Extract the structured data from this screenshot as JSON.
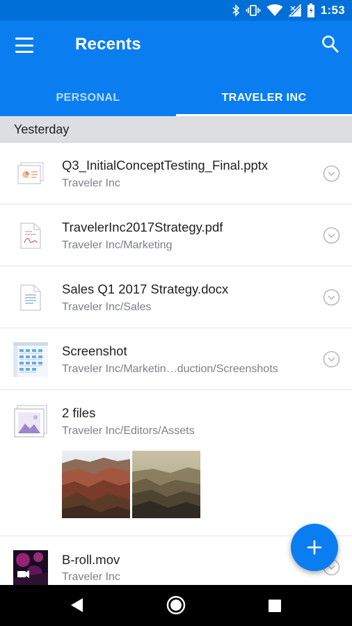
{
  "status_bar": {
    "time": "1:53",
    "icons": [
      "bluetooth-icon",
      "vibrate-icon",
      "wifi-icon",
      "signal-icon",
      "battery-icon"
    ]
  },
  "app_bar": {
    "title": "Recents",
    "tabs": [
      {
        "label": "PERSONAL",
        "active": false
      },
      {
        "label": "TRAVELER INC",
        "active": true
      }
    ]
  },
  "section": {
    "label": "Yesterday"
  },
  "files": [
    {
      "name": "Q3_InitialConceptTesting_Final.pptx",
      "path": "Traveler Inc",
      "icon": "pptx-file-icon"
    },
    {
      "name": "TravelerInc2017Strategy.pdf",
      "path": "Traveler Inc/Marketing",
      "icon": "pdf-file-icon"
    },
    {
      "name": "Sales Q1 2017 Strategy.docx",
      "path": "Traveler Inc/Sales",
      "icon": "docx-file-icon"
    },
    {
      "name": "Screenshot",
      "path": "Traveler Inc/Marketin…duction/Screenshots",
      "icon": "screenshot-thumbnail"
    },
    {
      "name": "2 files",
      "path": "Traveler Inc/Editors/Assets",
      "icon": "image-stack-icon"
    },
    {
      "name": "B-roll.mov",
      "path": "Traveler Inc",
      "icon": "video-thumbnail"
    }
  ],
  "colors": {
    "status_bar": "#0070d8",
    "app_bar": "#0a7ef0",
    "section_bg": "#dcdee2",
    "text_primary": "#1e1f21",
    "text_secondary": "#7c8087"
  }
}
